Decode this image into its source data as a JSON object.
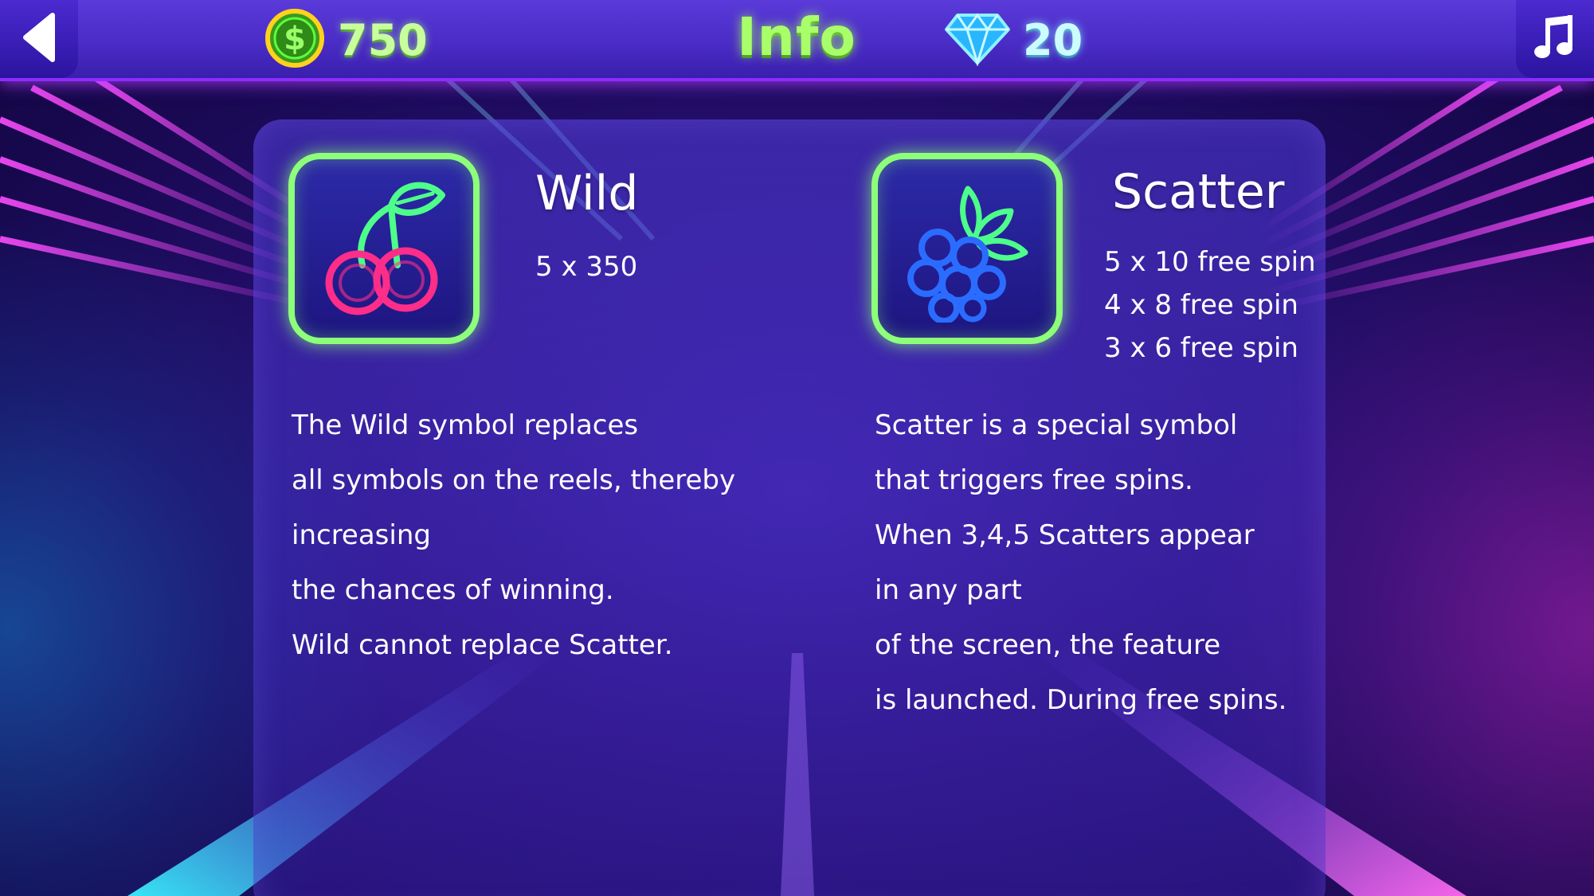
{
  "header": {
    "title": "Info",
    "coins": "750",
    "gems": "20"
  },
  "icons": {
    "back": "chevron-left-icon",
    "music": "music-note-icon",
    "coin": "dollar-coin-icon",
    "gem": "diamond-icon",
    "wild_symbol": "cherry-icon",
    "scatter_symbol": "grapes-icon"
  },
  "colors": {
    "title_green": "#a8ff6a",
    "frame_green": "#8dff7a",
    "cherry_pink": "#ff2d8a",
    "grape_blue": "#2a6cff",
    "leaf_green": "#4dff8a",
    "topbar_purple": "#4a2cc6"
  },
  "wild": {
    "title": "Wild",
    "payouts": [
      "5 x 350"
    ],
    "description": [
      "The Wild symbol replaces",
      "all symbols on the reels, thereby",
      "increasing",
      "the chances of winning.",
      "Wild cannot replace Scatter."
    ]
  },
  "scatter": {
    "title": "Scatter",
    "payouts": [
      "5 x 10 free spin",
      "4 x 8 free spin",
      "3 x 6 free spin"
    ],
    "description": [
      "Scatter is a special symbol",
      "that triggers free spins.",
      "When 3,4,5 Scatters appear",
      "in any part",
      "of the screen, the feature",
      "is launched. During free spins."
    ]
  }
}
